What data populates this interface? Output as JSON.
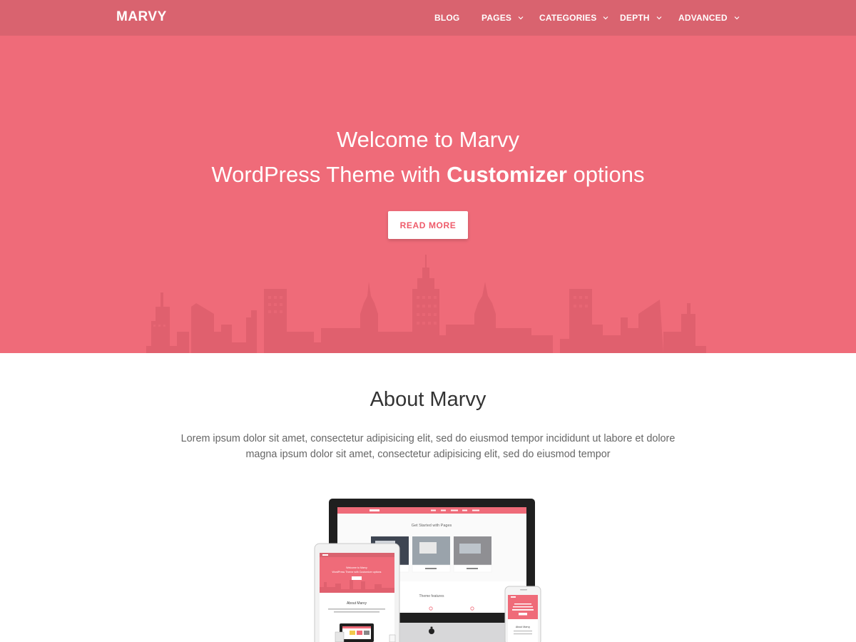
{
  "navbar": {
    "brand": "MARVY",
    "menu": [
      {
        "label": "BLOG",
        "dropdown": false
      },
      {
        "label": "PAGES",
        "dropdown": true
      },
      {
        "label": "CATEGORIES",
        "dropdown": true
      },
      {
        "label": "DEPTH",
        "dropdown": true
      },
      {
        "label": "ADVANCED",
        "dropdown": true
      }
    ]
  },
  "hero": {
    "line1": "Welcome to Marvy",
    "line2_prefix": "WordPress Theme with ",
    "line2_bold": "Customizer",
    "line2_suffix": " options",
    "button": "READ MORE"
  },
  "about": {
    "title": "About Marvy",
    "text_line1": "Lorem ipsum dolor sit amet, consectetur adipisicing elit, sed do eiusmod tempor incididunt ut labore et dolore",
    "text_line2": "magna ipsum dolor sit amet, consectetur adipisicing elit, sed do eiusmod tempor"
  },
  "devices_preview": {
    "desktop_heading": "Get Started with Pages",
    "desktop_section": "Theme features",
    "tablet_about": "About Marvy",
    "tablet_hero": "Welcome to Marvy WordPress Theme with Customizer options"
  },
  "colors": {
    "primary": "#ef6b79",
    "navbar": "#d9636f",
    "skyline": "#e0606e",
    "button_text": "#ef5b6a"
  }
}
